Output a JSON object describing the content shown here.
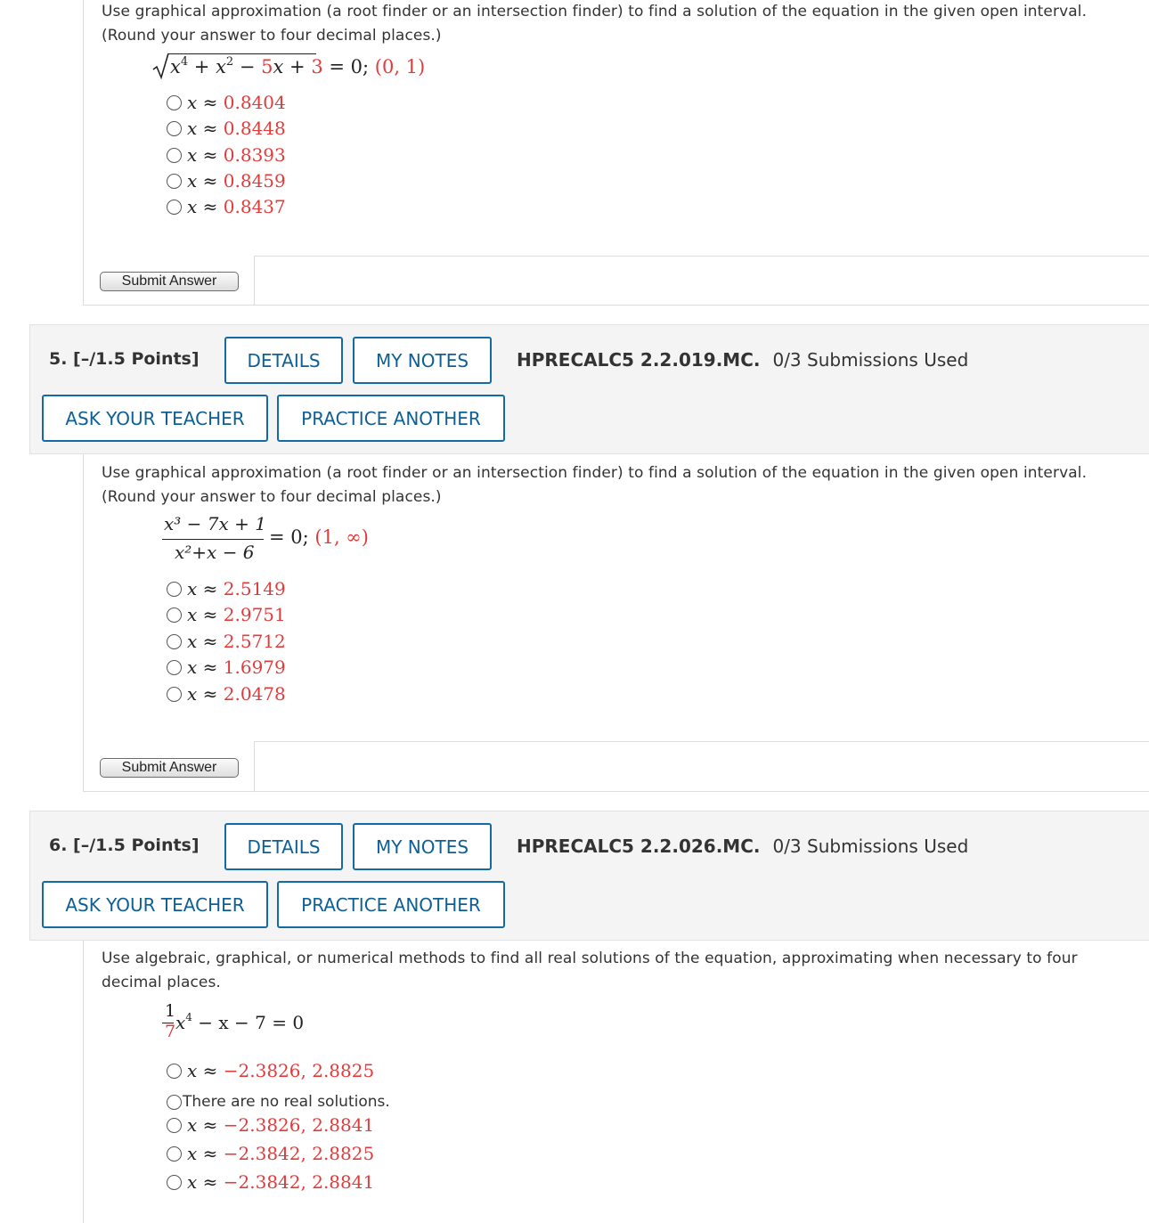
{
  "q4": {
    "prompt_line1": "Use graphical approximation (a root finder or an intersection finder) to find a solution of the equation in the given open interval.",
    "prompt_line2": "(Round your answer to four decimal places.)",
    "equation": {
      "x4": "x",
      "e4": "4",
      "plus1": " + ",
      "x2": "x",
      "e2": "2",
      "minus": " − ",
      "c5": "5",
      "x": "x",
      "plus2": " + ",
      "c3": "3",
      "rest": " = 0;  ",
      "interval": "(0, 1)"
    },
    "choices": [
      {
        "var": "x",
        "sym": " ≈ ",
        "value": "0.8404"
      },
      {
        "var": "x",
        "sym": " ≈ ",
        "value": "0.8448"
      },
      {
        "var": "x",
        "sym": " ≈ ",
        "value": "0.8393"
      },
      {
        "var": "x",
        "sym": " ≈ ",
        "value": "0.8459"
      },
      {
        "var": "x",
        "sym": " ≈ ",
        "value": "0.8437"
      }
    ],
    "submit_label": "Submit Answer"
  },
  "q5": {
    "number_label": "5.  [–/1.5 Points]",
    "details_label": "DETAILS",
    "notes_label": "MY NOTES",
    "code": "HPRECALC5 2.2.019.MC.",
    "submissions": "0/3 Submissions Used",
    "ask_label": "ASK YOUR TEACHER",
    "practice_label": "PRACTICE ANOTHER",
    "prompt_line1": "Use graphical approximation (a root finder or an intersection finder) to find a solution of the equation in the given open interval.",
    "prompt_line2": "(Round your answer to four decimal places.)",
    "equation": {
      "numerator": "x³ − 7x + 1",
      "denominator": "x²+x − 6",
      "rest": "= 0;  ",
      "interval": "(1, ∞)"
    },
    "choices": [
      {
        "var": "x",
        "sym": " ≈ ",
        "value": "2.5149"
      },
      {
        "var": "x",
        "sym": " ≈ ",
        "value": "2.9751"
      },
      {
        "var": "x",
        "sym": " ≈ ",
        "value": "2.5712"
      },
      {
        "var": "x",
        "sym": " ≈ ",
        "value": "1.6979"
      },
      {
        "var": "x",
        "sym": " ≈ ",
        "value": "2.0478"
      }
    ],
    "submit_label": "Submit Answer"
  },
  "q6": {
    "number_label": "6.  [–/1.5 Points]",
    "details_label": "DETAILS",
    "notes_label": "MY NOTES",
    "code": "HPRECALC5 2.2.026.MC.",
    "submissions": "0/3 Submissions Used",
    "ask_label": "ASK YOUR TEACHER",
    "practice_label": "PRACTICE ANOTHER",
    "prompt_line1": "Use algebraic, graphical, or numerical methods to find all real solutions of the equation, approximating when necessary to four",
    "prompt_line2": "decimal places.",
    "equation": {
      "frac_num": "1",
      "frac_den": "7",
      "x": "x",
      "e4": "4",
      "rest": " − x − 7 = 0"
    },
    "choices": [
      {
        "var": "x",
        "sym": " ≈ ",
        "value": "−2.3826, 2.8825"
      },
      {
        "text": "There are no real solutions."
      },
      {
        "var": "x",
        "sym": " ≈ ",
        "value": "−2.3826, 2.8841"
      },
      {
        "var": "x",
        "sym": " ≈ ",
        "value": "−2.3842, 2.8825"
      },
      {
        "var": "x",
        "sym": " ≈ ",
        "value": "−2.3842, 2.8841"
      }
    ]
  }
}
